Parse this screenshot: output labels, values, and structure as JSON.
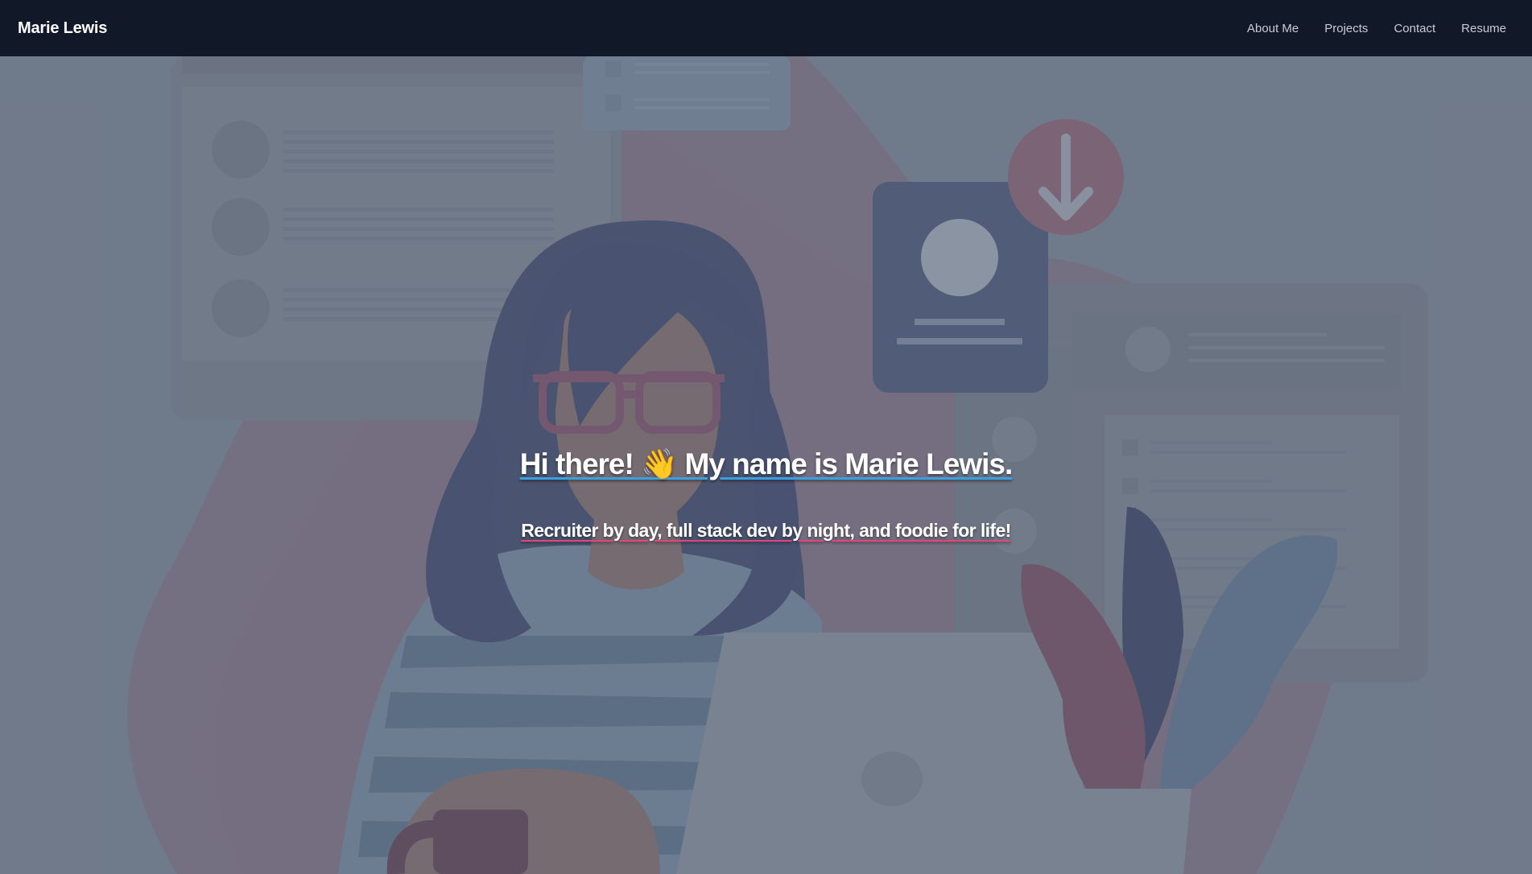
{
  "navbar": {
    "brand": "Marie Lewis",
    "links": [
      "About Me",
      "Projects",
      "Contact",
      "Resume"
    ]
  },
  "hero": {
    "headline": "Hi there! 👋 My name is Marie Lewis.",
    "tagline": "Recruiter by day, full stack dev by night, and foodie for life!"
  },
  "colors": {
    "navbar_bg": "#111827",
    "headline_underline": "#3aa0e0",
    "tagline_underline": "#e0457b"
  }
}
